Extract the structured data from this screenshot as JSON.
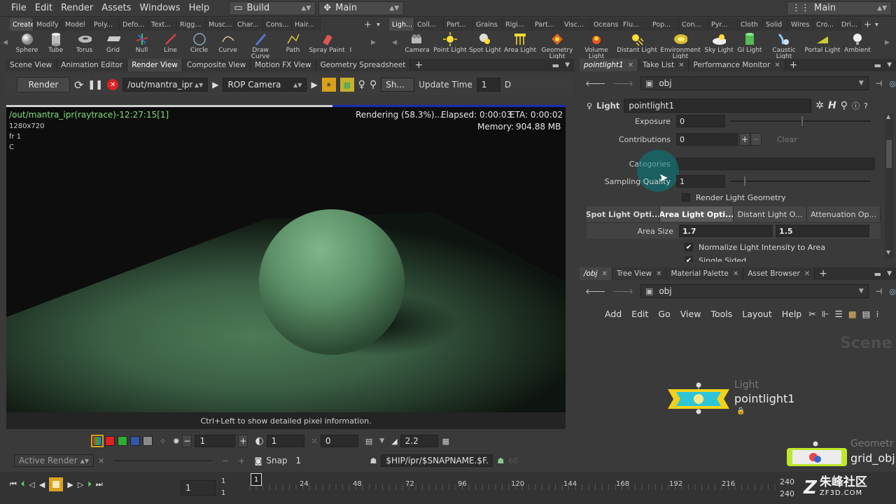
{
  "menubar": {
    "items": [
      "File",
      "Edit",
      "Render",
      "Assets",
      "Windows",
      "Help"
    ],
    "desktop_combo": "Build",
    "main_combo": "Main",
    "right_combo": "Main"
  },
  "shelf_left": {
    "tabs": [
      "Create",
      "Modify",
      "Model",
      "Poly...",
      "Defo...",
      "Text...",
      "Rigg...",
      "Musc...",
      "Char...",
      "Cons...",
      "Hair..."
    ],
    "tools": [
      "Sphere",
      "Tube",
      "Torus",
      "Grid",
      "Null",
      "Line",
      "Circle",
      "Curve",
      "Draw Curve",
      "Path",
      "Spray Paint",
      "I"
    ]
  },
  "shelf_right": {
    "tabs": [
      "Ligh...",
      "Coll...",
      "Part...",
      "Grains",
      "Rigi...",
      "Part...",
      "Visc...",
      "Oceans",
      "Flu...",
      "Pop...",
      "Con...",
      "Pyr...",
      "Cloth",
      "Solid",
      "Wires",
      "Cro...",
      "Dri..."
    ],
    "tools": [
      "Camera",
      "Point Light",
      "Spot Light",
      "Area Light",
      "Geometry Light",
      "Volume Light",
      "Distant Light",
      "Environment Light",
      "Sky Light",
      "GI Light",
      "Caustic Light",
      "Portal Light",
      "Ambient"
    ]
  },
  "left_pane_tabs": [
    "Scene View",
    "Animation Editor",
    "Render View",
    "Composite View",
    "Motion FX View",
    "Geometry Spreadsheet"
  ],
  "render_toolbar": {
    "render_label": "Render",
    "driver_path": "/out/mantra_ipr",
    "camera": "ROP Camera",
    "sh_label": "Sh...",
    "update_time_label": "Update Time",
    "update_time_value": "1",
    "d_label": "D"
  },
  "render_overlay": {
    "title": "/out/mantra_ipr(raytrace)-12:27:15[1]",
    "resolution": "1280x720",
    "frame": "fr 1",
    "channel": "C",
    "status": "Rendering (58.3%)...",
    "elapsed": "Elapsed: 0:00:03",
    "eta": "ETA: 0:00:02",
    "memory_label": "Memory:",
    "memory_value": "904.88 MB",
    "progress": 0.583
  },
  "pixel_info": "Ctrl+Left to show detailed pixel information.",
  "render_bottom": {
    "zoom_value": "1",
    "exposure_value": "1",
    "offset_value": "0",
    "gamma_value": "2.2",
    "active_render": "Active Render",
    "snap_label": "Snap",
    "snap_value": "1",
    "snapname": "$HIP/ipr/$SNAPNAME.$F.",
    "dim_value": "60"
  },
  "right_top_tabs": [
    "pointlight1",
    "Take List",
    "Performance Monitor"
  ],
  "param_path": "obj",
  "param_header": {
    "type": "Light",
    "name": "pointlight1"
  },
  "params": {
    "exposure_label": "Exposure",
    "exposure_value": "0",
    "contributions_label": "Contributions",
    "contributions_value": "0",
    "clear_label": "Clear",
    "categories_label": "Categories",
    "sampling_label": "Sampling Quality",
    "sampling_value": "1",
    "render_geo_label": "Render Light Geometry",
    "folder_tabs": [
      "Spot Light Opti...",
      "Area Light Opti...",
      "Distant Light O...",
      "Attenuation Op..."
    ],
    "area_size_label": "Area Size",
    "area_size_x": "1.7",
    "area_size_y": "1.5",
    "normalize_label": "Normalize Light Intensity to Area",
    "single_sided_label": "Single Sided"
  },
  "right_bottom_tabs": [
    "/obj",
    "Tree View",
    "Material Palette",
    "Asset Browser"
  ],
  "net_path": "obj",
  "net_menu": [
    "Add",
    "Edit",
    "Go",
    "View",
    "Tools",
    "Layout",
    "Help"
  ],
  "network": {
    "watermark": "Scene",
    "light_node_type": "Light",
    "light_node_name": "pointlight1",
    "geo_node_type": "Geometr",
    "geo_node_name": "grid_obj"
  },
  "timeline": {
    "current_frame": "1",
    "start": "1",
    "end_top": "1",
    "end_bottom": "1",
    "range_end_top": "240",
    "range_end_bottom": "240",
    "ticks": [
      "1",
      "24",
      "48",
      "72",
      "96",
      "120",
      "144",
      "168",
      "192",
      "216",
      "240"
    ]
  },
  "watermark": {
    "cn": "朱峰社区",
    "url": "ZF3D.COM"
  },
  "colors": {
    "accent_blue": "#1a2cb4",
    "overlay_green": "#7fe07a",
    "light_node_yellow": "#f2d21b",
    "light_node_cyan": "#2cc6d8"
  }
}
